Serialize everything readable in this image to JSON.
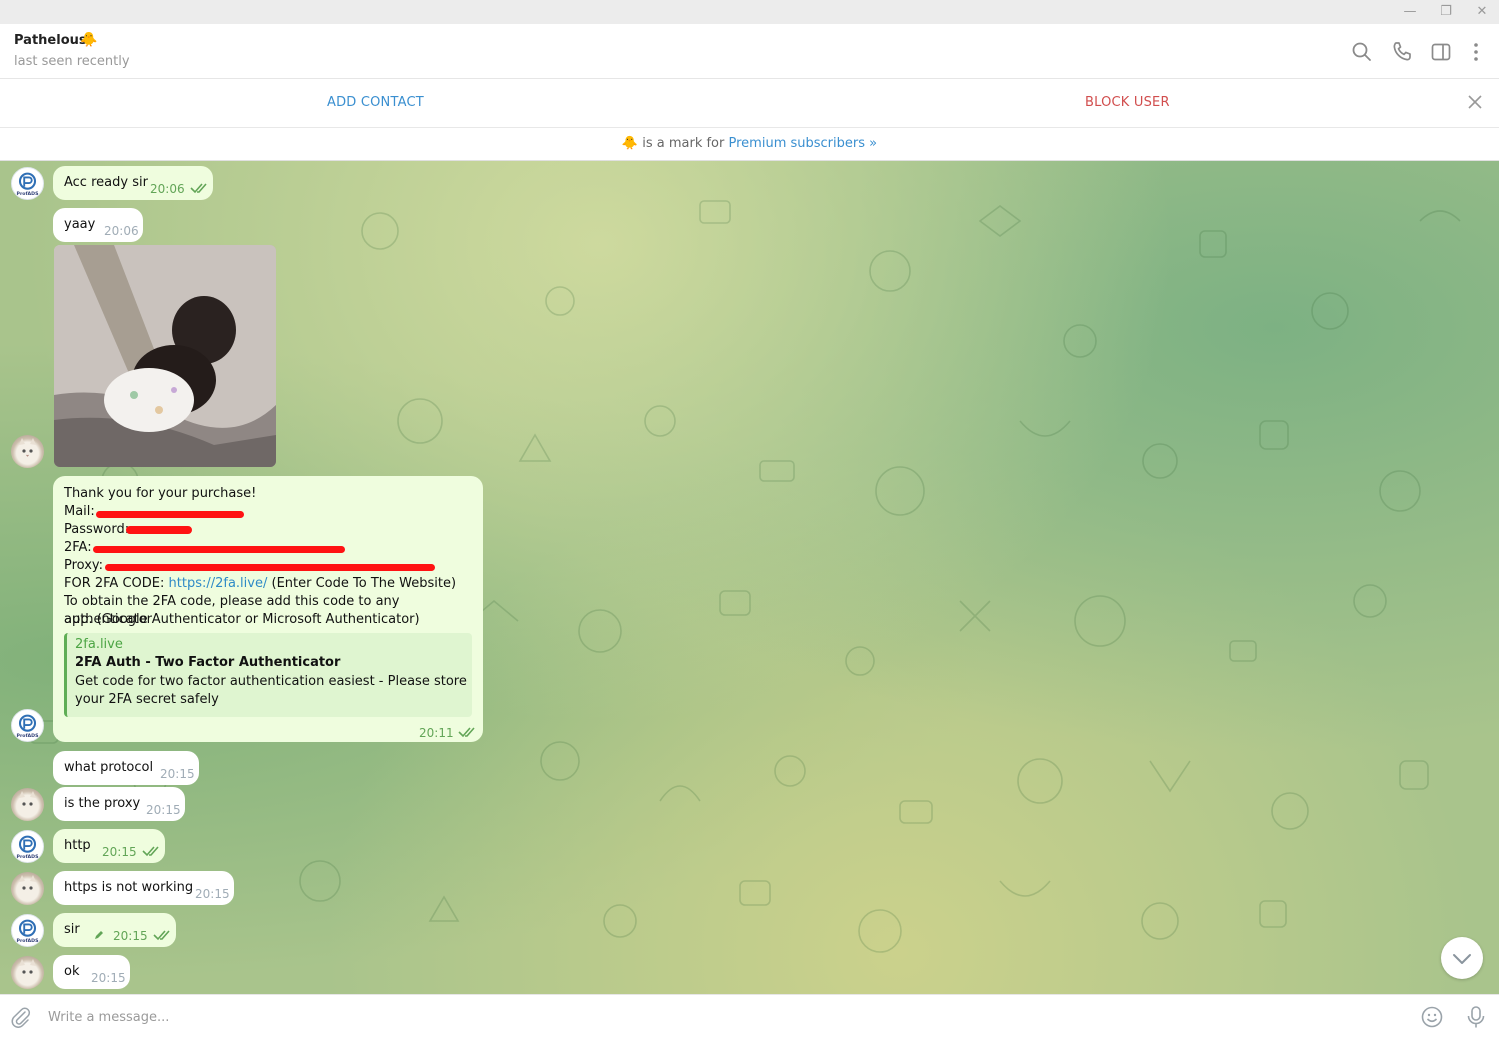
{
  "window": {
    "minimize": "—",
    "restore": "❐",
    "close": "✕"
  },
  "header": {
    "peer_name": "Pathelous",
    "peer_emoji": "🐥",
    "peer_status": "last seen recently",
    "icons": [
      "search-icon",
      "phone-icon",
      "sidebar-icon",
      "more-icon"
    ]
  },
  "action_bar": {
    "add_contact": "ADD CONTACT",
    "block_user": "BLOCK USER"
  },
  "premium_bar": {
    "emoji": "🐥",
    "text": "is a mark for",
    "link": "Premium subscribers »"
  },
  "messages": [
    {
      "dir": "out",
      "text": "Acc ready sir",
      "time": "20:06",
      "read": true
    },
    {
      "dir": "in",
      "text": "yaay",
      "time": "20:06"
    },
    {
      "dir": "in",
      "type": "photo"
    },
    {
      "dir": "out",
      "lines": {
        "thanks": "Thank you for your purchase!",
        "mail": "Mail:",
        "password": "Password:",
        "twofa": "2FA:",
        "proxy": "Proxy:",
        "code_prefix": "FOR 2FA CODE:",
        "code_link": "https://2fa.live/",
        "code_suffix": "(Enter Code To The Website)",
        "obtain_1": "To obtain the 2FA code, please add this code to any authenticator",
        "obtain_2": "app. (Google Authenticator or Microsoft Authenticator)"
      },
      "preview": {
        "site": "2fa.live",
        "title": "2FA Auth - Two Factor Authenticator",
        "desc": "Get code for two factor authentication easiest - Please store your 2FA secret safely"
      },
      "time": "20:11",
      "read": true
    },
    {
      "dir": "in",
      "text": "what protocol",
      "time": "20:15"
    },
    {
      "dir": "in",
      "text": "is the proxy",
      "time": "20:15"
    },
    {
      "dir": "out",
      "text": "http",
      "time": "20:15",
      "read": true
    },
    {
      "dir": "in",
      "text": "https is not working",
      "time": "20:15"
    },
    {
      "dir": "out",
      "text": "sir",
      "time": "20:15",
      "read": true,
      "edited": true
    },
    {
      "dir": "in",
      "text": "ok",
      "time": "20:15"
    }
  ],
  "avatars": {
    "prof_label": "ProfADS"
  },
  "composer": {
    "placeholder": "Write a message..."
  },
  "colors": {
    "link": "#3a8fd0",
    "danger": "#d14e4e",
    "out_bubble": "#effdde",
    "in_bubble": "#ffffff"
  }
}
